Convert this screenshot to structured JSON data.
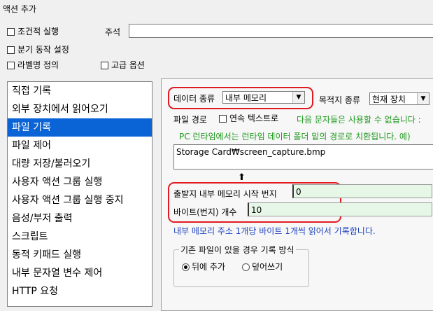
{
  "window": {
    "title": "액션 추가"
  },
  "options": {
    "conditional_exec": "조건적 실행",
    "memo_label": "주석",
    "branch_settings": "분기 동작 설정",
    "label_define": "라벨명 정의",
    "advanced": "고급 옵션"
  },
  "action_list": [
    "직접 기록",
    "외부 장치에서 읽어오기",
    "파일 기록",
    "파일 제어",
    "대량 저장/불러오기",
    "사용자 액션 그룹 실행",
    "사용자 액션 그룹 실행 중지",
    "음성/부저 출력",
    "스크립트",
    "동적 키패드 실행",
    "내부 문자열 변수 제어",
    "HTTP 요청"
  ],
  "selected_action": "파일 기록",
  "panel": {
    "data_type_label": "데이터 종류",
    "data_type_value": "내부 메모리",
    "dest_type_label": "목적지 종류",
    "dest_type_value": "현재 장치",
    "file_path_label": "파일 경로",
    "continuous_text": "연속 텍스트로",
    "warning_line1": "다음 문자들은 사용할 수 없습니다 :",
    "warning_line2": "PC 런타임에서는 런타임 데이터 폴더 밑의 경로로 치환됩니다. 예)",
    "file_path_value": "Storage Card₩screen_capture.bmp",
    "start_addr_label": "출발지 내부 메모리 시작 번지",
    "start_addr_value": "0",
    "byte_count_label": "바이트(번지) 개수",
    "byte_count_value": "10",
    "info_text": "내부 메모리 주소 1개당 바이트 1개씩 읽어서 기록합니다.",
    "existing_group_title": "기존 파일이 있을 경우 기록 방식",
    "append_label": "뒤에 추가",
    "overwrite_label": "덮어쓰기"
  },
  "colors": {
    "highlight": "#e11b22",
    "selection": "#0a64d6",
    "green_text": "#1e9a1e",
    "blue_text": "#1a3fbf"
  }
}
